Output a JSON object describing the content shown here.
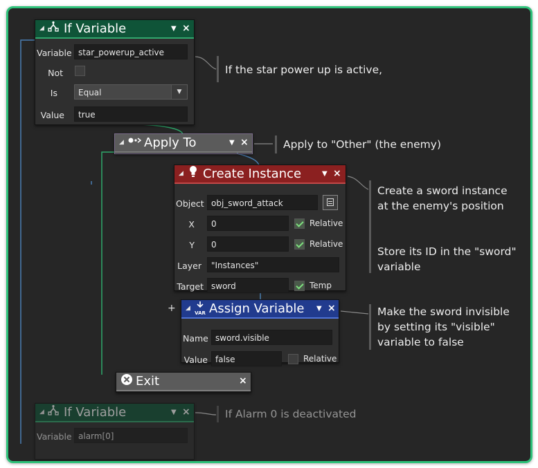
{
  "nodes": {
    "if_variable_1": {
      "title": "If Variable",
      "icon": "branch-icon",
      "fields": {
        "variable_label": "Variable",
        "variable_value": "star_powerup_active",
        "not_label": "Not",
        "not_checked": false,
        "is_label": "Is",
        "is_value": "Equal",
        "value_label": "Value",
        "value_value": "true"
      }
    },
    "apply_to": {
      "title": "Apply To",
      "icon": "apply-to-icon"
    },
    "create_instance": {
      "title": "Create Instance",
      "icon": "lightbulb-icon",
      "fields": {
        "object_label": "Object",
        "object_value": "obj_sword_attack",
        "x_label": "X",
        "x_value": "0",
        "x_relative_label": "Relative",
        "x_relative_checked": true,
        "y_label": "Y",
        "y_value": "0",
        "y_relative_label": "Relative",
        "y_relative_checked": true,
        "layer_label": "Layer",
        "layer_value": "\"Instances\"",
        "target_label": "Target",
        "target_value": "sword",
        "temp_label": "Temp",
        "temp_checked": true
      }
    },
    "assign_variable": {
      "title": "Assign Variable",
      "icon": "var-icon",
      "icon_text": "VAR",
      "fields": {
        "name_label": "Name",
        "name_value": "sword.visible",
        "value_label": "Value",
        "value_value": "false",
        "relative_label": "Relative",
        "relative_checked": false
      }
    },
    "exit": {
      "title": "Exit",
      "icon": "exit-icon"
    },
    "if_variable_2": {
      "title": "If Variable",
      "icon": "branch-icon",
      "fields": {
        "variable_label": "Variable",
        "variable_value": "alarm[0]"
      }
    }
  },
  "comments": {
    "c1": "If the star power up is active,",
    "c2": "Apply to \"Other\" (the enemy)",
    "c3": "Create a sword instance at the enemy's position",
    "c4": "Store its ID in the \"sword\" variable",
    "c5": "Make the sword invisible by setting its \"visible\" variable to false",
    "c6": "If Alarm 0 is deactivated"
  },
  "colors": {
    "frame_border": "#2ec27a",
    "canvas_bg": "#262626",
    "if_variable_header": "#0f5438",
    "apply_to_header": "#5b5b5b",
    "create_instance_header": "#8b2020",
    "assign_variable_header": "#213b8e",
    "exit_header": "#5b5b5b"
  }
}
